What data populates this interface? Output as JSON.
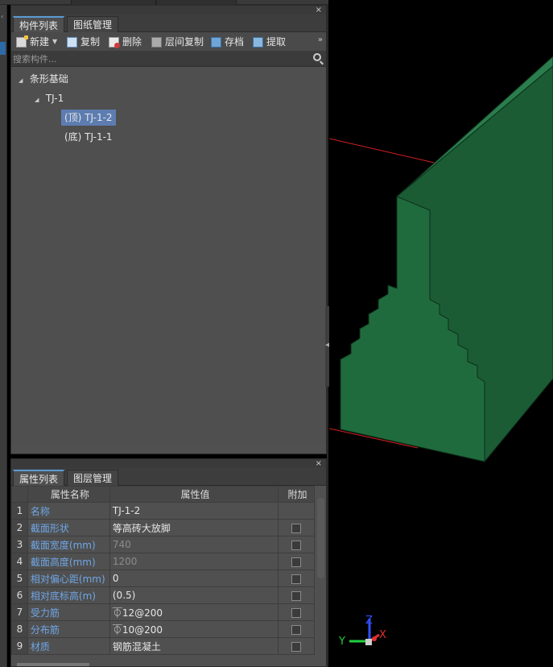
{
  "component_panel": {
    "tabs": [
      {
        "label": "构件列表",
        "active": true
      },
      {
        "label": "图纸管理",
        "active": false
      }
    ],
    "toolbar": {
      "new": "新建",
      "copy": "复制",
      "delete": "删除",
      "layer_copy": "层间复制",
      "save": "存档",
      "fetch": "提取"
    },
    "search_placeholder": "搜索构件...",
    "tree": {
      "root": "条形基础",
      "child": "TJ-1",
      "items": [
        {
          "label": "(顶)  TJ-1-2",
          "selected": true
        },
        {
          "label": "(底)  TJ-1-1",
          "selected": false
        }
      ]
    }
  },
  "property_panel": {
    "tabs": [
      {
        "label": "属性列表",
        "active": true
      },
      {
        "label": "图层管理",
        "active": false
      }
    ],
    "columns": [
      "属性名称",
      "属性值",
      "附加"
    ],
    "rows": [
      {
        "num": "1",
        "name": "名称",
        "value": "TJ-1-2",
        "grey": false,
        "checkbox": false
      },
      {
        "num": "2",
        "name": "截面形状",
        "value": "等高砖大放脚",
        "grey": false,
        "checkbox": true
      },
      {
        "num": "3",
        "name": "截面宽度(mm)",
        "value": "740",
        "grey": true,
        "checkbox": true
      },
      {
        "num": "4",
        "name": "截面高度(mm)",
        "value": "1200",
        "grey": true,
        "checkbox": true
      },
      {
        "num": "5",
        "name": "相对偏心距(mm)",
        "value": "0",
        "grey": false,
        "checkbox": true
      },
      {
        "num": "6",
        "name": "相对底标高(m)",
        "value": "(0.5)",
        "grey": false,
        "checkbox": true
      },
      {
        "num": "7",
        "name": "受力筋",
        "value": "⏁12@200",
        "grey": false,
        "checkbox": true
      },
      {
        "num": "8",
        "name": "分布筋",
        "value": "⏁10@200",
        "grey": false,
        "checkbox": true
      },
      {
        "num": "9",
        "name": "材质",
        "value": "钢筋混凝土",
        "grey": false,
        "checkbox": true
      }
    ]
  },
  "viewport": {
    "axis_labels": {
      "x": "X",
      "y": "Y",
      "z": "Z"
    },
    "colors": {
      "model_front": "#1f6b3d",
      "model_side": "#1b5c35",
      "model_top": "#2a7d4c",
      "edge": "#0d2e1a",
      "ref_line": "#d42020",
      "axis_x": "#e03030",
      "axis_y": "#20d040",
      "axis_z": "#3050ff"
    }
  }
}
